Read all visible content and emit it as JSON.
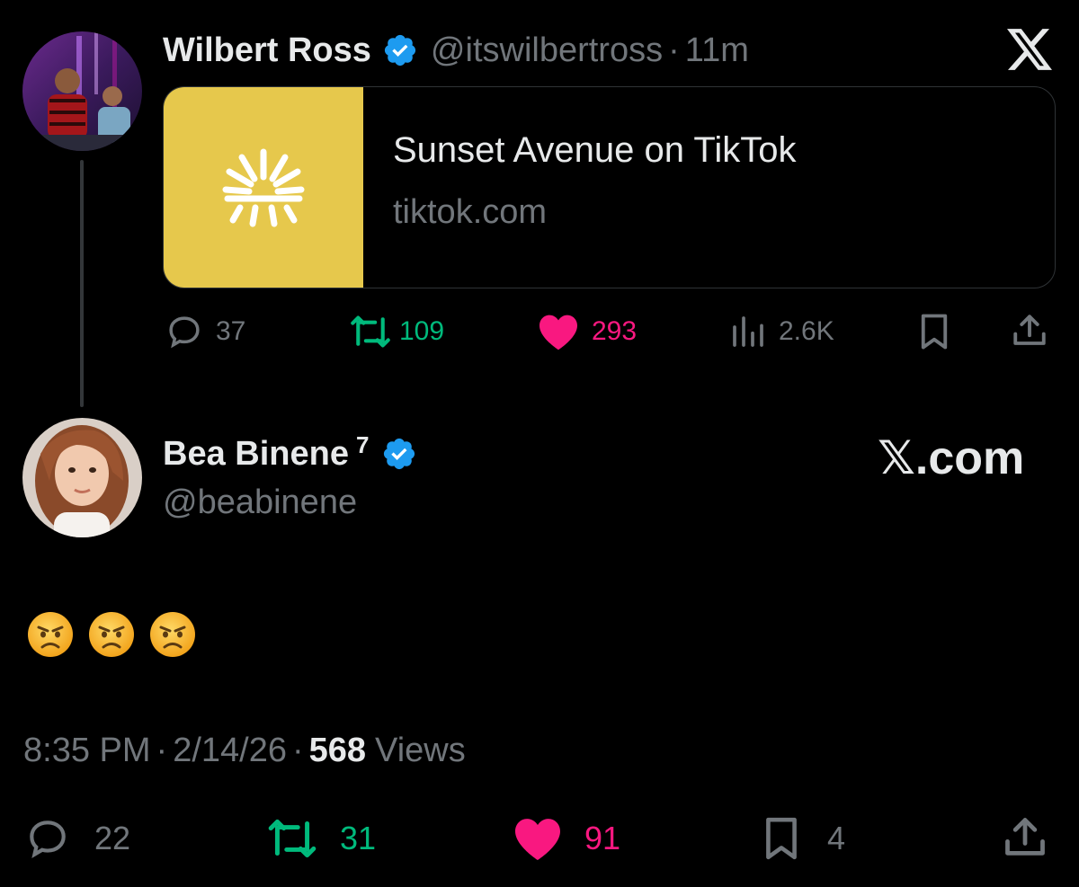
{
  "top_tweet": {
    "author_name": "Wilbert Ross",
    "handle": "@itswilbertross",
    "separator": "·",
    "time_ago": "11m",
    "card": {
      "title": "Sunset Avenue on TikTok",
      "domain": "tiktok.com",
      "thumb_color": "#e6c84c"
    },
    "stats": {
      "replies": "37",
      "reposts": "109",
      "likes": "293",
      "views": "2.6K"
    }
  },
  "main_tweet": {
    "author_name": "Bea Binene",
    "superscript": "7",
    "handle": "@beabinene",
    "body_emojis": [
      "angry-face",
      "angry-face",
      "angry-face"
    ],
    "timestamp_time": "8:35 PM",
    "dot1": "·",
    "timestamp_date": "2/14/26",
    "dot2": "·",
    "views_count": "568",
    "views_label": "Views",
    "stats": {
      "replies": "22",
      "reposts": "31",
      "likes": "91",
      "bookmarks": "4"
    }
  },
  "branding": {
    "x_com_label": "𝕏.com"
  },
  "colors": {
    "background": "#000000",
    "verified_blue": "#1d9bf0",
    "repost_green": "#00ba7c",
    "like_pink": "#f91880",
    "muted": "#71767b"
  }
}
